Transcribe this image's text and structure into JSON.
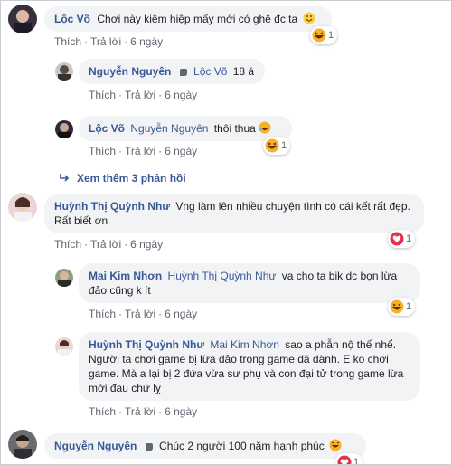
{
  "comments": [
    {
      "name": "Lộc Võ",
      "tag": "",
      "text": "Chơi này kiêm hiệp mấy mới có ghệ đc ta",
      "reaction_count": "1"
    },
    {
      "name": "Nguyễn Nguyên",
      "tag": "Lộc Võ",
      "text": "18 á",
      "reaction_count": ""
    },
    {
      "name": "Lộc Võ",
      "tag": "Nguyễn Nguyên",
      "text": "thôi thua",
      "reaction_count": "1"
    },
    {
      "name": "Huỳnh Thị Quỳnh Như",
      "tag": "",
      "text": "Vng làm lên nhiều chuyện tình có cái kết rất đẹp. Rất biết ơn",
      "reaction_count": "1"
    },
    {
      "name": "Mai Kim Nhơn",
      "tag": "Huỳnh Thị Quỳnh Như",
      "text": "va cho ta bik dc bọn lừa đảo cũng k ít",
      "reaction_count": "1"
    },
    {
      "name": "Huỳnh Thị Quỳnh Như",
      "tag": "Mai Kim Nhơn",
      "text": "sao a phẫn nộ thế nhể. Người ta chơi game bị lừa đảo trong game đã đành. E ko chơi game. Mà a lại bị 2 đứa vừa sư phụ và con đại tử trong game lừa mới đau chứ lỵ",
      "reaction_count": ""
    },
    {
      "name": "Nguyễn Nguyên",
      "tag": "",
      "text": "Chúc 2 người 100 năm hạnh phúc",
      "reaction_count": "1"
    }
  ],
  "actions": {
    "like": "Thích",
    "reply": "Trả lời",
    "time": "6 ngày",
    "sep": "·"
  },
  "more_replies": "Xem thêm 3 phản hồi",
  "colors": {
    "link": "#385898",
    "bubble": "#f2f3f5",
    "meta": "#606770",
    "heart": "#e4304f",
    "haha": "#f7b125"
  },
  "icons": [
    "wave-icon",
    "haha-emoji-icon",
    "laugh-emoji-icon",
    "heart-reaction-icon",
    "reply-arrow-icon",
    "smile-emoji-icon"
  ]
}
